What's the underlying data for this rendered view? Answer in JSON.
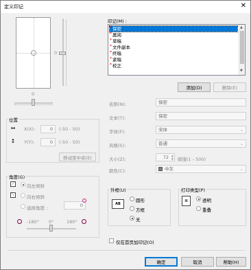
{
  "window": {
    "title": "定义印记",
    "close_icon": "close-icon"
  },
  "preview": {
    "top_value": "0",
    "right_value": "0",
    "bottom_value": "0"
  },
  "position": {
    "label": "位置",
    "x_label": "X(X):",
    "x_value": "0",
    "x_range": "(-50 - 50)",
    "y_label": "Y(Y):",
    "y_value": "0",
    "y_range": "(-50 - 50)",
    "center_button": "移动至中央(E)"
  },
  "angle": {
    "label": "角度(G)",
    "options": [
      "向左倾斜",
      "向右倾斜",
      "选择角度 :"
    ],
    "selected": 0,
    "custom_value": "0",
    "scale": [
      "-180°",
      "0°",
      "180°"
    ]
  },
  "stamp": {
    "label": "印记(M) :",
    "items": [
      "保密",
      "属阅",
      "草稿",
      "文件副本",
      "终稿",
      "紧稿",
      "校正"
    ],
    "selected": 0,
    "add_button": "添加(D)",
    "delete_button": "删除(E)"
  },
  "fields": {
    "name_label": "名称(N):",
    "name_value": "保密",
    "text_label": "文本(T):",
    "text_value": "保密",
    "font_label": "字体(F):",
    "font_value": "宋体",
    "style_label": "风格(S):",
    "style_value": "普通",
    "size_label": "大小(Z):",
    "size_value": "72",
    "size_unit": "磅值(1 - 500)",
    "color_label": "颜色(C):",
    "color_value": "中灰",
    "color_hex": "#808080"
  },
  "frame": {
    "label": "外框(U)",
    "options": [
      "圆形",
      "方框",
      "无"
    ],
    "selected": 2,
    "icon_text": "AB"
  },
  "print_type": {
    "label": "打印类型(P)",
    "options": [
      "透明",
      "重叠"
    ],
    "selected": 0
  },
  "first_page": {
    "label": "仅在首页加印记(O)",
    "checked": false
  },
  "buttons": {
    "ok": "确定",
    "cancel": "取消",
    "help": "帮助(H)"
  }
}
